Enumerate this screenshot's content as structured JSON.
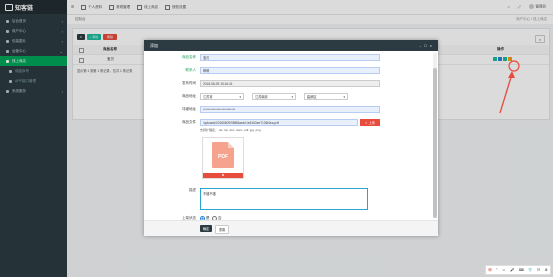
{
  "app": {
    "logo": "知客链"
  },
  "sidebar": {
    "items": [
      {
        "label": "后台首页"
      },
      {
        "label": "商户中心"
      },
      {
        "label": "包装图片"
      },
      {
        "label": "运营中心"
      },
      {
        "label": "线上商店"
      },
      {
        "label": "佣金序号"
      },
      {
        "label": "APP接口管理"
      },
      {
        "label": "系统服务"
      }
    ]
  },
  "topbar": {
    "menu": [
      "个人资料",
      "常规管理",
      "线上商店",
      "授权设置"
    ],
    "user": "管理员"
  },
  "tabbar": {
    "tab": "控制台",
    "breadcrumb": "商户中心 / 线上商店"
  },
  "list": {
    "buttons": {
      "refresh": "C",
      "add": "+ 添加",
      "delete": "删除"
    },
    "headers": {
      "name": "商品名称",
      "status": "状态",
      "actions": "操作"
    },
    "row_name": "宝贝",
    "pager": "显示第 1 到第 1 条记录，总共 1 条记录"
  },
  "modal": {
    "title": "添加",
    "controls": "- □ ×",
    "fields": {
      "name": {
        "label": "商品名称",
        "value": "宝贝"
      },
      "contact": {
        "label": "联系人",
        "value": "咻咻"
      },
      "time": {
        "label": "发布时间",
        "value": "2018-08-09 15:16:41"
      },
      "region": {
        "label": "商品地址",
        "province": "江苏省",
        "city": "江苏南京",
        "district": "建邺区"
      },
      "address": {
        "label": "详细地址",
        "value": "**************************"
      },
      "file": {
        "label": "商品文件",
        "value": "/uploads/20180809/95f88ae4e1e6163ee7136f4ea.pdf",
        "upload": "上传"
      },
      "hint": "支持扩展名：.rar .zip .doc .docx .pdf .jpg .png",
      "pdf_icon_text": "PDF",
      "pdf_delete": "✖",
      "desc": {
        "label": "描述",
        "value": "不错不错"
      },
      "status": {
        "label": "上架状态",
        "options": [
          "是",
          "否"
        ],
        "selected": "是"
      }
    },
    "footer": {
      "ok": "确定",
      "reset": "重置"
    }
  },
  "taskbar": {
    "items": [
      "中",
      "°",
      "☺",
      "🎤",
      "⌨",
      "👕",
      "☷",
      "⚙"
    ]
  },
  "colors": {
    "sidebar": "#2c3b41",
    "accent_green": "#18bc9c",
    "danger": "#e74c3c",
    "annotation_arrow": "#e74c3c"
  }
}
